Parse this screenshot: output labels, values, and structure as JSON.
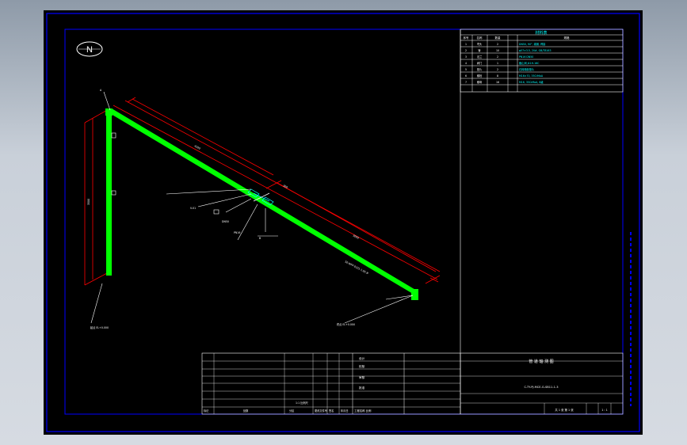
{
  "drawing": {
    "north_symbol": "N",
    "colors": {
      "background": "#000000",
      "frame": "#0000ff",
      "pipe": "#00ff00",
      "dimension": "#ff0000",
      "text": "#ffffff",
      "table_text": "#00ffff",
      "outer_bg": "#c9d0d9"
    },
    "title_block": {
      "title": "管  道  轴  测  图",
      "drawing_no": "C-TY-PJ-MCE-G-SB11-1-3",
      "sheet_info": "共 1 张 第 1 张",
      "scale": "1 : 1",
      "left_rows": [
        "设计",
        "校核",
        "审核",
        "批准"
      ],
      "mid_label": "工程名称 比例",
      "sign_labels": [
        "标记",
        "处数",
        "分区",
        "更改文件号",
        "签名",
        "年月日"
      ],
      "bottom_note": "1:1 比例尺"
    },
    "material_table": {
      "header": "材料表",
      "columns": [
        "序号",
        "名称",
        "数量",
        "规格"
      ],
      "rows": [
        [
          "1",
          "弯头",
          "2",
          "DN50, 90°, 碳钢, 焊接"
        ],
        [
          "2",
          "管",
          "10",
          "φ57×3.5, 20#, GB/T8163"
        ],
        [
          "3",
          "法兰",
          "2",
          "PN16 DN50"
        ],
        [
          "4",
          "阀门",
          "1",
          "截止阀 J41H-16C"
        ],
        [
          "5",
          "垫片",
          "2",
          "石棉橡胶垫片"
        ],
        [
          "6",
          "螺栓",
          "8",
          "M16×70, 35CrMoA"
        ],
        [
          "7",
          "螺母",
          "16",
          "M16, 35CrMoA, 8级"
        ]
      ]
    },
    "annotations": {
      "start_point": "起点 EL+0.000",
      "end_point": "终点 EL+0.000",
      "valve_tag": "V-01",
      "pipe_tag": "50-WFP-0101-1.0C-B",
      "dim_top": "4500",
      "dim_mid": "3000",
      "dim_vertical": "3500",
      "dim_short": "300",
      "label_a": "A",
      "label_b": "B",
      "leader_1": "DN50",
      "leader_2": "PN16"
    }
  }
}
